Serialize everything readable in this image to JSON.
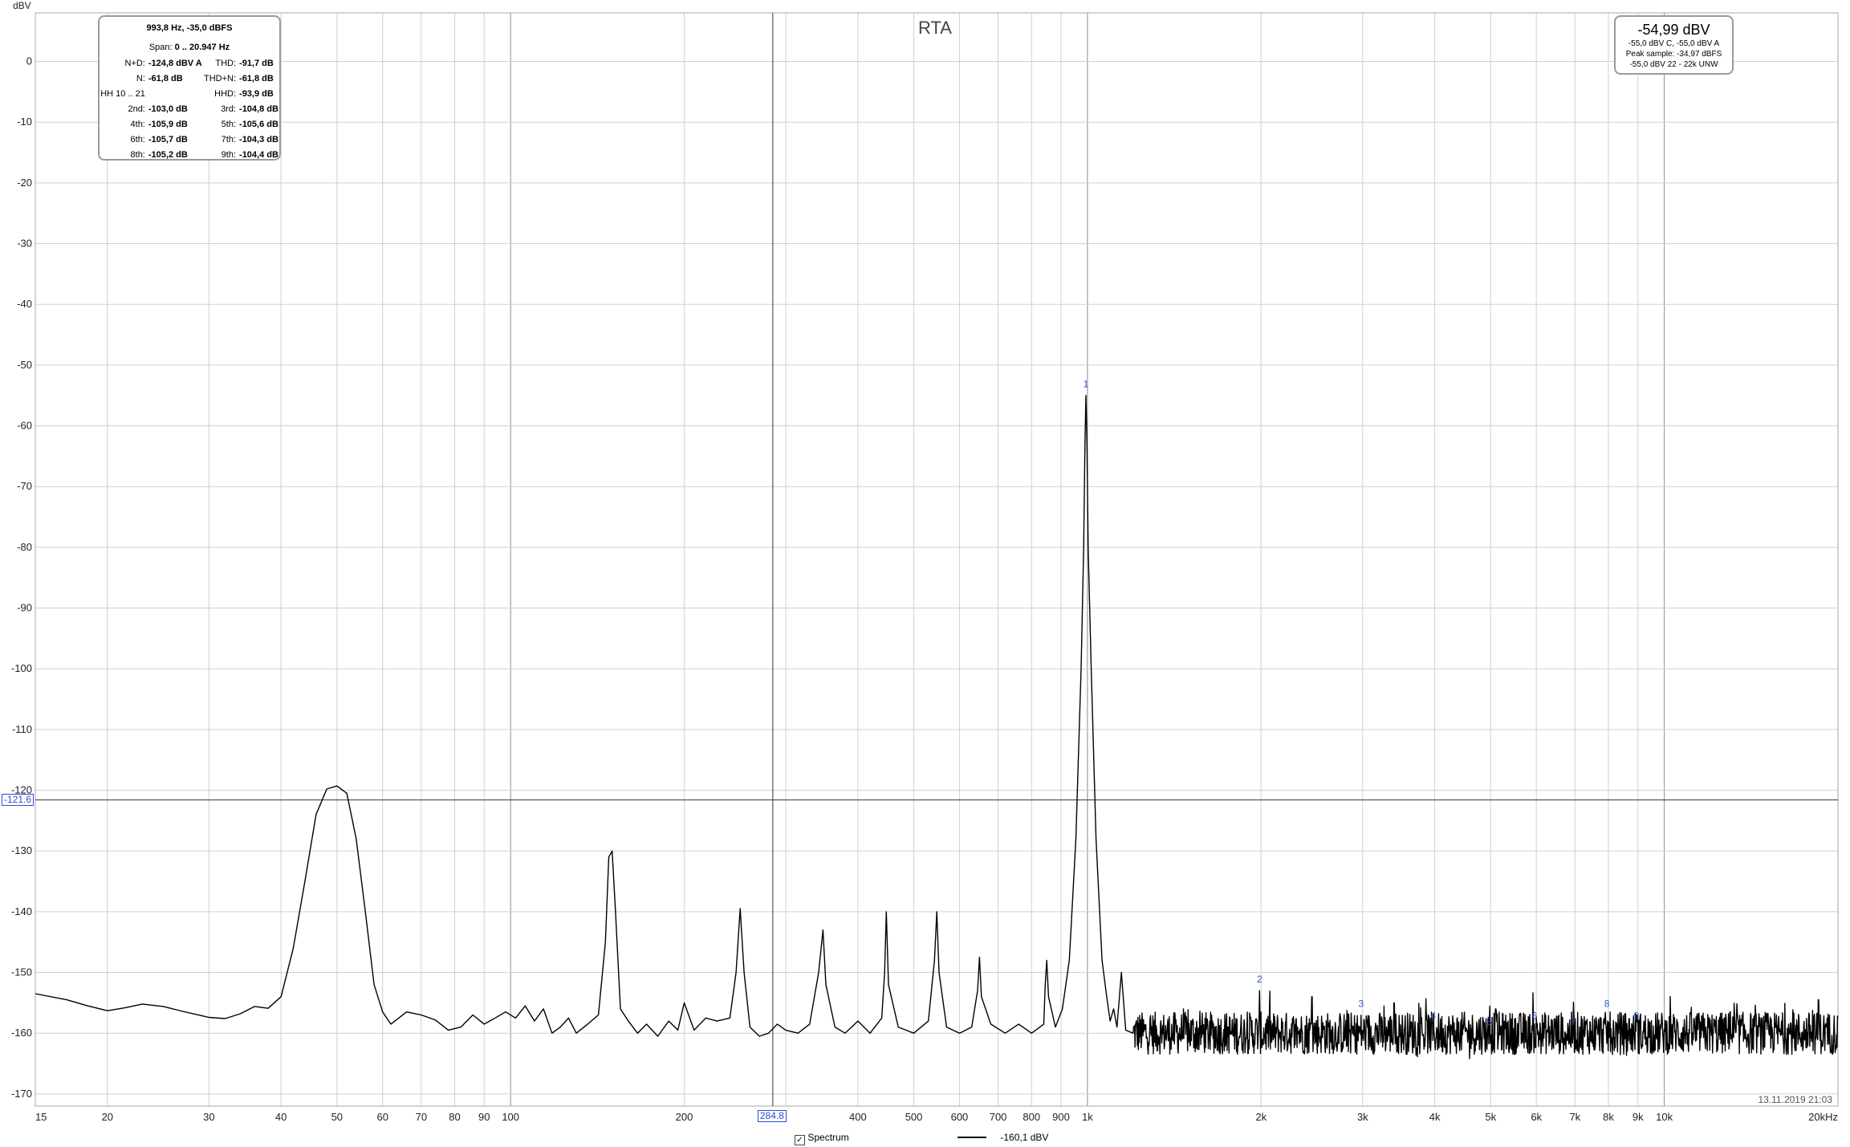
{
  "chart_data": {
    "type": "line",
    "title": "RTA",
    "y_unit": "dBV",
    "xscale": "log",
    "xlim": [
      15,
      20000
    ],
    "ylim": [
      -172,
      8
    ],
    "y_ticks": [
      0,
      -10,
      -20,
      -30,
      -40,
      -50,
      -60,
      -70,
      -80,
      -90,
      -100,
      -110,
      -120,
      -130,
      -140,
      -150,
      -160,
      -170
    ],
    "x_ticks": [
      {
        "v": 15,
        "label": "15"
      },
      {
        "v": 20,
        "label": "20"
      },
      {
        "v": 30,
        "label": "30"
      },
      {
        "v": 40,
        "label": "40"
      },
      {
        "v": 50,
        "label": "50"
      },
      {
        "v": 60,
        "label": "60"
      },
      {
        "v": 70,
        "label": "70"
      },
      {
        "v": 80,
        "label": "80"
      },
      {
        "v": 90,
        "label": "90"
      },
      {
        "v": 100,
        "label": "100"
      },
      {
        "v": 200,
        "label": "200"
      },
      {
        "v": 400,
        "label": "400"
      },
      {
        "v": 500,
        "label": "500"
      },
      {
        "v": 600,
        "label": "600"
      },
      {
        "v": 700,
        "label": "700"
      },
      {
        "v": 800,
        "label": "800"
      },
      {
        "v": 900,
        "label": "900"
      },
      {
        "v": 1000,
        "label": "1k"
      },
      {
        "v": 2000,
        "label": "2k"
      },
      {
        "v": 3000,
        "label": "3k"
      },
      {
        "v": 4000,
        "label": "4k"
      },
      {
        "v": 5000,
        "label": "5k"
      },
      {
        "v": 6000,
        "label": "6k"
      },
      {
        "v": 7000,
        "label": "7k"
      },
      {
        "v": 8000,
        "label": "8k"
      },
      {
        "v": 9000,
        "label": "9k"
      },
      {
        "v": 10000,
        "label": "10k"
      },
      {
        "v": 20000,
        "label": "20kHz"
      }
    ],
    "grid": true,
    "series": [
      {
        "name": "Spectrum",
        "color": "#000000",
        "noise_floor_above_1k": -160,
        "points": [
          [
            15,
            -153.5
          ],
          [
            17,
            -154.5
          ],
          [
            18.5,
            -155.5
          ],
          [
            20,
            -156.3
          ],
          [
            21.5,
            -155.8
          ],
          [
            23,
            -155.2
          ],
          [
            25,
            -155.6
          ],
          [
            27,
            -156.4
          ],
          [
            30,
            -157.4
          ],
          [
            32,
            -157.6
          ],
          [
            34,
            -156.8
          ],
          [
            36,
            -155.6
          ],
          [
            38,
            -155.9
          ],
          [
            40,
            -154.0
          ],
          [
            42,
            -146.0
          ],
          [
            44,
            -135.0
          ],
          [
            46,
            -124.0
          ],
          [
            48,
            -119.8
          ],
          [
            50,
            -119.3
          ],
          [
            52,
            -120.5
          ],
          [
            54,
            -128.0
          ],
          [
            56,
            -140.0
          ],
          [
            58,
            -152.0
          ],
          [
            60,
            -156.5
          ],
          [
            62,
            -158.5
          ],
          [
            64,
            -157.5
          ],
          [
            66,
            -156.5
          ],
          [
            70,
            -157.0
          ],
          [
            74,
            -157.8
          ],
          [
            78,
            -159.5
          ],
          [
            82,
            -159.0
          ],
          [
            86,
            -157.0
          ],
          [
            90,
            -158.5
          ],
          [
            94,
            -157.5
          ],
          [
            98,
            -156.5
          ],
          [
            102,
            -157.5
          ],
          [
            106,
            -155.5
          ],
          [
            110,
            -158.0
          ],
          [
            114,
            -156.0
          ],
          [
            118,
            -160.0
          ],
          [
            122,
            -159.0
          ],
          [
            126,
            -157.5
          ],
          [
            130,
            -160.0
          ],
          [
            136,
            -158.5
          ],
          [
            142,
            -157.0
          ],
          [
            146,
            -145.0
          ],
          [
            148,
            -131.0
          ],
          [
            150,
            -130.0
          ],
          [
            152,
            -140.0
          ],
          [
            155,
            -156.0
          ],
          [
            160,
            -158.0
          ],
          [
            166,
            -160.0
          ],
          [
            172,
            -158.5
          ],
          [
            180,
            -160.5
          ],
          [
            188,
            -158.0
          ],
          [
            195,
            -159.5
          ],
          [
            200,
            -155.0
          ],
          [
            208,
            -159.5
          ],
          [
            218,
            -157.5
          ],
          [
            228,
            -158.0
          ],
          [
            240,
            -157.5
          ],
          [
            246,
            -150.0
          ],
          [
            250,
            -139.5
          ],
          [
            254,
            -150.0
          ],
          [
            260,
            -159.0
          ],
          [
            270,
            -160.5
          ],
          [
            280,
            -160.0
          ],
          [
            290,
            -158.5
          ],
          [
            300,
            -159.5
          ],
          [
            315,
            -160.0
          ],
          [
            330,
            -158.5
          ],
          [
            342,
            -150.0
          ],
          [
            348,
            -143.0
          ],
          [
            352,
            -152.0
          ],
          [
            365,
            -159.0
          ],
          [
            380,
            -160.0
          ],
          [
            400,
            -158.0
          ],
          [
            420,
            -160.0
          ],
          [
            440,
            -157.5
          ],
          [
            445,
            -150.0
          ],
          [
            448,
            -140.0
          ],
          [
            452,
            -152.0
          ],
          [
            470,
            -159.0
          ],
          [
            500,
            -160.0
          ],
          [
            530,
            -158.0
          ],
          [
            543,
            -148.0
          ],
          [
            548,
            -140.0
          ],
          [
            553,
            -150.0
          ],
          [
            570,
            -159.0
          ],
          [
            600,
            -160.0
          ],
          [
            630,
            -159.0
          ],
          [
            645,
            -153.0
          ],
          [
            650,
            -147.5
          ],
          [
            655,
            -154.0
          ],
          [
            680,
            -158.5
          ],
          [
            720,
            -160.0
          ],
          [
            760,
            -158.5
          ],
          [
            800,
            -160.0
          ],
          [
            840,
            -158.5
          ],
          [
            845,
            -152.0
          ],
          [
            850,
            -148.0
          ],
          [
            856,
            -154.0
          ],
          [
            880,
            -159.0
          ],
          [
            905,
            -156.0
          ],
          [
            930,
            -148.0
          ],
          [
            955,
            -128.0
          ],
          [
            975,
            -100.0
          ],
          [
            985,
            -80.0
          ],
          [
            990,
            -63.0
          ],
          [
            993.8,
            -55.0
          ],
          [
            998,
            -63.0
          ],
          [
            1003,
            -80.0
          ],
          [
            1015,
            -100.0
          ],
          [
            1035,
            -128.0
          ],
          [
            1060,
            -148.0
          ],
          [
            1080,
            -154.0
          ],
          [
            1095,
            -158.0
          ],
          [
            1110,
            -156.0
          ],
          [
            1125,
            -159.0
          ],
          [
            1145,
            -150.0
          ],
          [
            1165,
            -159.5
          ],
          [
            1200,
            -160.0
          ]
        ]
      }
    ]
  },
  "stats_box": {
    "header": "993,8 Hz, -35,0 dBFS",
    "span_label": "Span:",
    "span_value": "0 .. 20.947 Hz",
    "rows": [
      {
        "k1": "N+D:",
        "v1": "-124,8 dBV A",
        "k2": "THD:",
        "v2": "-91,7 dB"
      },
      {
        "k1": "N:",
        "v1": "-61,8 dB",
        "k2": "THD+N:",
        "v2": "-61,8 dB"
      },
      {
        "k1": "HH 10 .. 21",
        "v1": "",
        "k2": "HHD:",
        "v2": "-93,9 dB"
      },
      {
        "k1": "2nd:",
        "v1": "-103,0 dB",
        "k2": "3rd:",
        "v2": "-104,8 dB"
      },
      {
        "k1": "4th:",
        "v1": "-105,9 dB",
        "k2": "5th:",
        "v2": "-105,6 dB"
      },
      {
        "k1": "6th:",
        "v1": "-105,7 dB",
        "k2": "7th:",
        "v2": "-104,3 dB"
      },
      {
        "k1": "8th:",
        "v1": "-105,2 dB",
        "k2": "9th:",
        "v2": "-104,4 dB"
      }
    ]
  },
  "level_box": {
    "main": "-54,99 dBV",
    "line1": "-55,0 dBV C, -55,0 dBV A",
    "line2": "Peak sample: -34,97 dBFS",
    "line3": "-55,0 dBV 22 - 22k UNW"
  },
  "cursor": {
    "x_value": 284.8,
    "x_label": "284.8",
    "y_value": -121.6,
    "y_label": "-121.6"
  },
  "harmonic_markers": [
    {
      "label": "1",
      "freq": 993.8,
      "level": -55
    },
    {
      "label": "2",
      "freq": 1987.6,
      "level": -153
    },
    {
      "label": "3",
      "freq": 2981.4,
      "level": -157
    },
    {
      "label": "4",
      "freq": 3975.2,
      "level": -159
    },
    {
      "label": "5",
      "freq": 4969.0,
      "level": -160
    },
    {
      "label": "6",
      "freq": 5962.8,
      "level": -159
    },
    {
      "label": "7",
      "freq": 6956.6,
      "level": -160
    },
    {
      "label": "8",
      "freq": 7950.4,
      "level": -157
    },
    {
      "label": "9",
      "freq": 8944.2,
      "level": -159
    }
  ],
  "legend": {
    "checkbox_mark": "✓",
    "label": "Spectrum",
    "cursor_value": "-160,1 dBV"
  },
  "timestamp": "13.11.2019 21:03"
}
